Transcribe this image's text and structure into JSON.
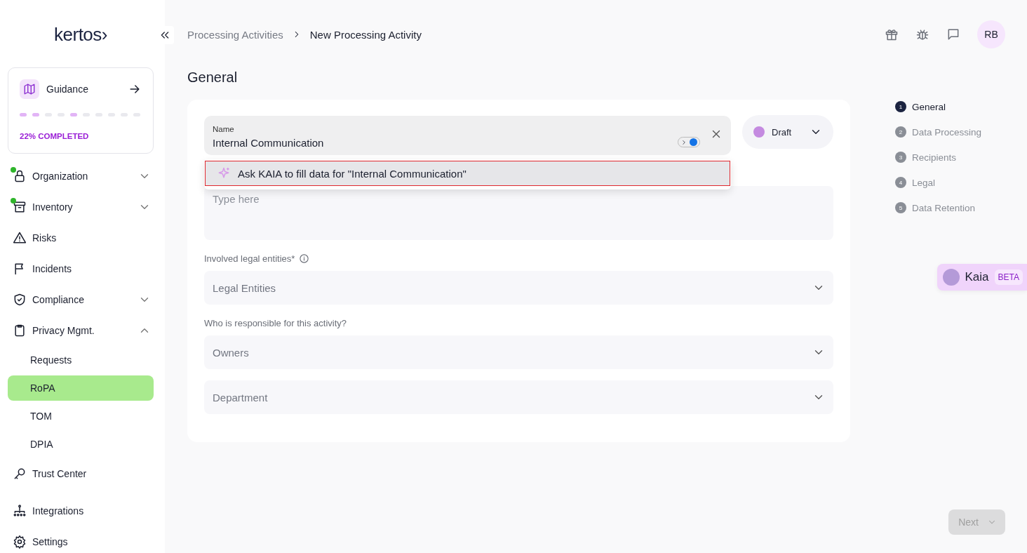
{
  "logo": "kertos›",
  "guidance": {
    "title": "Guidance",
    "progress_steps": [
      {
        "done": true
      },
      {
        "done": true
      },
      {
        "done": false
      },
      {
        "done": false
      },
      {
        "done": true
      },
      {
        "done": false
      },
      {
        "done": false
      },
      {
        "done": false
      },
      {
        "done": false
      },
      {
        "done": false
      }
    ],
    "status": "22% COMPLETED"
  },
  "nav": [
    {
      "label": "Organization",
      "dot": true,
      "expandable": true,
      "expanded": false,
      "selected": false
    },
    {
      "label": "Inventory",
      "dot": true,
      "expandable": true,
      "expanded": false,
      "selected": false
    },
    {
      "label": "Risks",
      "dot": false,
      "expandable": false,
      "selected": false
    },
    {
      "label": "Incidents",
      "dot": false,
      "expandable": false,
      "selected": false
    },
    {
      "label": "Compliance",
      "dot": false,
      "expandable": true,
      "expanded": false,
      "selected": false
    },
    {
      "label": "Privacy Mgmt.",
      "dot": false,
      "expandable": true,
      "expanded": true,
      "selected": false,
      "children": [
        {
          "label": "Requests",
          "selected": false
        },
        {
          "label": "RoPA",
          "selected": true
        },
        {
          "label": "TOM",
          "selected": false
        },
        {
          "label": "DPIA",
          "selected": false
        }
      ]
    },
    {
      "label": "Trust Center",
      "dot": false,
      "expandable": false,
      "selected": false
    },
    {
      "label": "Integrations",
      "dot": false,
      "expandable": false,
      "selected": false
    },
    {
      "label": "Settings",
      "dot": false,
      "expandable": false,
      "selected": false
    }
  ],
  "breadcrumb": [
    "Processing Activities",
    "New Processing Activity"
  ],
  "avatar": "RB",
  "page_title": "General",
  "form": {
    "name": {
      "label": "Name",
      "value": "Internal Communication"
    },
    "status": {
      "label": "Draft"
    },
    "suggestion": {
      "text": "Ask KAIA to fill data for \"Internal Communication\"",
      "highlighted": true
    },
    "description": {
      "placeholder": "Type here"
    },
    "fields": [
      {
        "label": "Involved legal entities*",
        "info": true,
        "placeholder": "Legal Entities"
      },
      {
        "label": "Who is responsible for this activity?",
        "info": false,
        "placeholder": "Owners"
      },
      {
        "placeholder": "Department"
      }
    ]
  },
  "steps": [
    {
      "number": "1",
      "label": "General",
      "selected": true
    },
    {
      "number": "2",
      "label": "Data Processing",
      "selected": false
    },
    {
      "number": "3",
      "label": "Recipients",
      "selected": false
    },
    {
      "number": "4",
      "label": "Legal",
      "selected": false
    },
    {
      "number": "5",
      "label": "Data Retention",
      "selected": false
    }
  ],
  "kaia": {
    "label": "Kaia",
    "badge": "BETA"
  },
  "next_button": {
    "label": "Next",
    "disabled": true
  }
}
